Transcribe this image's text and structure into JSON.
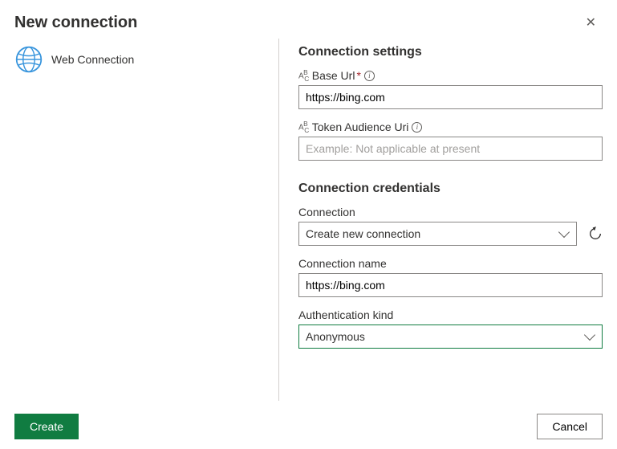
{
  "header": {
    "title": "New connection"
  },
  "left": {
    "selected": "Web Connection"
  },
  "settings": {
    "section_title": "Connection settings",
    "base_url": {
      "label": "Base Url",
      "required": true,
      "value": "https://bing.com"
    },
    "token_audience": {
      "label": "Token Audience Uri",
      "placeholder": "Example: Not applicable at present",
      "value": ""
    }
  },
  "credentials": {
    "section_title": "Connection credentials",
    "connection": {
      "label": "Connection",
      "selected": "Create new connection"
    },
    "connection_name": {
      "label": "Connection name",
      "value": "https://bing.com"
    },
    "auth_kind": {
      "label": "Authentication kind",
      "selected": "Anonymous"
    }
  },
  "footer": {
    "create": "Create",
    "cancel": "Cancel"
  }
}
